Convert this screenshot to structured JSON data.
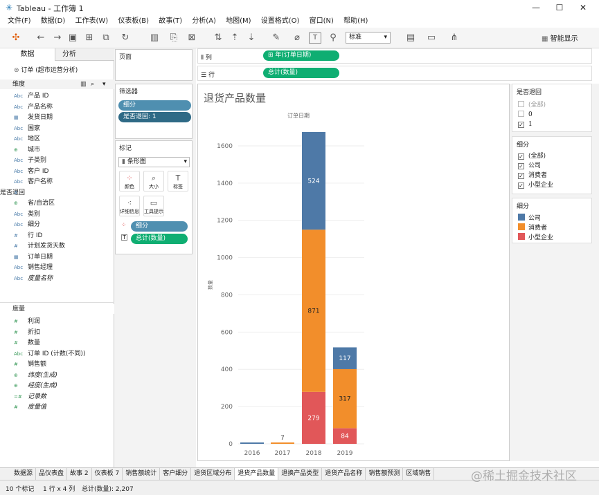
{
  "window": {
    "title": "Tableau - 工作簿 1",
    "min": "—",
    "max": "☐",
    "close": "✕"
  },
  "menu": [
    "文件(F)",
    "数据(D)",
    "工作表(W)",
    "仪表板(B)",
    "故事(T)",
    "分析(A)",
    "地图(M)",
    "设置格式(O)",
    "窗口(N)",
    "帮助(H)"
  ],
  "toolbar": {
    "fit_select": "标准",
    "smart_show": "智能显示"
  },
  "left": {
    "tab_data": "数据",
    "tab_analysis": "分析",
    "datasource": "订单 (超市运营分析)",
    "dimensions_header": "维度",
    "measures_header": "度量",
    "dimensions": [
      {
        "icon": "Abc",
        "label": "产品 ID"
      },
      {
        "icon": "Abc",
        "label": "产品名称"
      },
      {
        "icon": "▦",
        "label": "发货日期"
      },
      {
        "icon": "Abc",
        "label": "国家"
      },
      {
        "icon": "Abc",
        "label": "地区"
      },
      {
        "icon": "⊕",
        "label": "城市"
      },
      {
        "icon": "Abc",
        "label": "子类别"
      },
      {
        "icon": "Abc",
        "label": "客户 ID"
      },
      {
        "icon": "Abc",
        "label": "客户名称"
      },
      {
        "icon": "#",
        "label": "是否退回"
      },
      {
        "icon": "⊕",
        "label": "省/自治区"
      },
      {
        "icon": "Abc",
        "label": "类别"
      },
      {
        "icon": "Abc",
        "label": "细分"
      },
      {
        "icon": "#",
        "label": "行 ID"
      },
      {
        "icon": "#",
        "label": "计划发货天数"
      },
      {
        "icon": "▦",
        "label": "订单日期"
      },
      {
        "icon": "Abc",
        "label": "销售经理"
      },
      {
        "icon": "Abc",
        "label": "度量名称"
      }
    ],
    "measures": [
      {
        "icon": "#",
        "label": "利润"
      },
      {
        "icon": "#",
        "label": "折扣"
      },
      {
        "icon": "#",
        "label": "数量"
      },
      {
        "icon": "Abc",
        "label": "订单 ID (计数(不同))"
      },
      {
        "icon": "#",
        "label": "销售额"
      },
      {
        "icon": "⊕",
        "label": "纬度(生成)"
      },
      {
        "icon": "⊕",
        "label": "经度(生成)"
      },
      {
        "icon": "=#",
        "label": "记录数"
      },
      {
        "icon": "#",
        "label": "度量值"
      }
    ]
  },
  "mid": {
    "pages": "页面",
    "filters": "筛选器",
    "filter_pills": [
      "细分",
      "是否退回: 1"
    ],
    "marks": "标记",
    "mark_type": "条形图",
    "mark_buttons": [
      "颜色",
      "大小",
      "标签",
      "详细信息",
      "工具提示"
    ],
    "mark_pills": [
      "细分",
      "总计(数量)"
    ]
  },
  "shelves": {
    "columns_label": "列",
    "columns_pill": "年(订单日期)",
    "rows_label": "行",
    "rows_pill": "总计(数量)"
  },
  "viz_title": "退货产品数量",
  "chart_data": {
    "type": "bar",
    "stacked": true,
    "top_label": "订单日期",
    "ylabel": "数量",
    "categories": [
      "2016",
      "2017",
      "2018",
      "2019"
    ],
    "ylim": [
      0,
      1700
    ],
    "yticks": [
      0,
      200,
      400,
      600,
      800,
      1000,
      1200,
      1400,
      1600
    ],
    "series": [
      {
        "name": "小型企业",
        "color": "#e15759",
        "values": [
          0,
          0,
          279,
          84
        ]
      },
      {
        "name": "消费者",
        "color": "#f28e2b",
        "values": [
          0,
          7,
          871,
          317
        ]
      },
      {
        "name": "公司",
        "color": "#4e79a7",
        "values": [
          5,
          0,
          524,
          117
        ]
      }
    ],
    "labels": [
      [
        null,
        "279",
        "871",
        "524"
      ],
      [
        null,
        "84",
        "317",
        "117"
      ]
    ]
  },
  "right": {
    "filter1": {
      "title": "是否退回",
      "items": [
        {
          "label": "(全部)",
          "checked": false
        },
        {
          "label": "0",
          "checked": false
        },
        {
          "label": "1",
          "checked": true
        }
      ]
    },
    "filter2": {
      "title": "细分",
      "items": [
        {
          "label": "(全部)",
          "checked": true
        },
        {
          "label": "公司",
          "checked": true
        },
        {
          "label": "消费者",
          "checked": true
        },
        {
          "label": "小型企业",
          "checked": true
        }
      ]
    },
    "legend": {
      "title": "细分",
      "items": [
        {
          "label": "公司",
          "color": "#4e79a7"
        },
        {
          "label": "消费者",
          "color": "#f28e2b"
        },
        {
          "label": "小型企业",
          "color": "#e15759"
        }
      ]
    }
  },
  "bottom_tabs": [
    "数据源",
    "品仪表盘",
    "故事 2",
    "仪表板 7",
    "销售额统计",
    "客户细分",
    "退货区域分布",
    "退货产品数量",
    "退换产品类型",
    "退货产品名称",
    "销售额预测",
    "区域销售"
  ],
  "status": {
    "marks": "10 个标记",
    "rows": "1 行 x 4 列",
    "sum": "总计(数量): 2,207"
  },
  "watermark": "@稀土掘金技术社区"
}
